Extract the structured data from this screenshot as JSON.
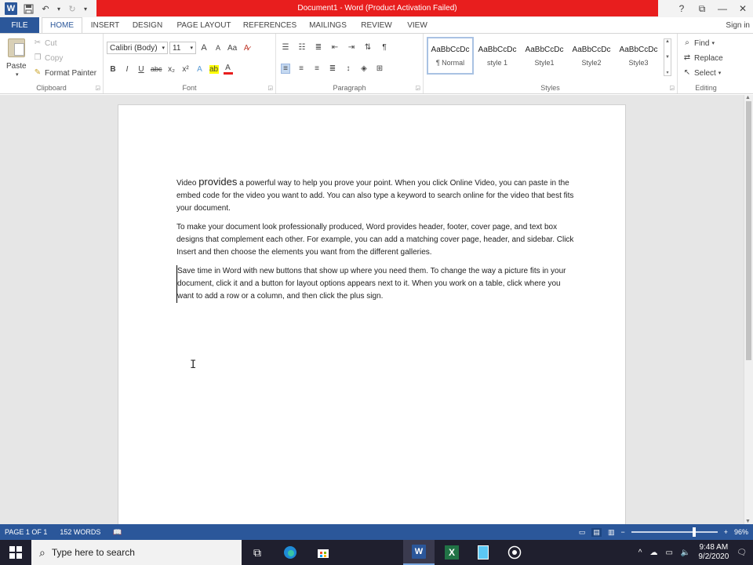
{
  "window": {
    "title": "Document1 - Word (Product Activation Failed)",
    "help_glyph": "?",
    "controls": [
      "?",
      "⧉",
      "—",
      "✕"
    ]
  },
  "qat": {
    "undo_glyph": "↶",
    "redo_glyph": "↻",
    "more_glyph": "▾"
  },
  "tabs": [
    "FILE",
    "HOME",
    "INSERT",
    "DESIGN",
    "PAGE LAYOUT",
    "REFERENCES",
    "MAILINGS",
    "REVIEW",
    "VIEW"
  ],
  "signin": "Sign in",
  "clipboard": {
    "paste": "Paste",
    "cut": "Cut",
    "copy": "Copy",
    "format_painter": "Format Painter",
    "label": "Clipboard"
  },
  "font": {
    "font_name": "Calibri (Body)",
    "font_size": "11",
    "grow": "A",
    "shrink": "A",
    "case": "Aa",
    "bold": "B",
    "italic": "I",
    "underline": "U",
    "strike": "abc",
    "subscript": "x₂",
    "superscript": "x²",
    "label": "Font"
  },
  "paragraph": {
    "label": "Paragraph"
  },
  "styles": {
    "items": [
      {
        "preview": "AaBbCcDc",
        "name": "¶ Normal"
      },
      {
        "preview": "AaBbCcDc",
        "name": "style 1"
      },
      {
        "preview": "AaBbCcDc",
        "name": "Style1"
      },
      {
        "preview": "AaBbCcDc",
        "name": "Style2"
      },
      {
        "preview": "AaBbCcDc",
        "name": "Style3"
      }
    ],
    "label": "Styles"
  },
  "editing": {
    "find": "Find",
    "replace": "Replace",
    "select": "Select",
    "label": "Editing"
  },
  "document": {
    "p1_word1": "Video",
    "p1_word2": "provides",
    "p1_rest": "a powerful way to help you prove your point. When you click Online Video, you can paste in the embed code for the video you want to add. You can also type a keyword to search online for the video that best fits your document.",
    "p2": "To make your document look professionally produced, Word provides header, footer, cover page, and text box designs that complement each other. For example, you can add a matching cover page, header, and sidebar. Click Insert and then choose the elements you want from the different galleries.",
    "p3": "Save time in Word with new buttons that show up where you need them. To change the way a picture fits in your document, click it and a button for layout options appears next to it. When you work on a table, click where you want to add a row or a column, and then click the plus sign."
  },
  "status": {
    "page": "PAGE 1 OF 1",
    "words": "152 WORDS",
    "zoom": "96%",
    "zoom_level": 0.96,
    "zoom_out": "−",
    "zoom_in": "+"
  },
  "taskbar": {
    "search_placeholder": "Type here to search",
    "time": "9:48 AM",
    "date": "9/2/2020"
  },
  "colors": {
    "word_blue": "#2b579a",
    "title_red": "#e81e1e",
    "taskbar": "#1f1f2e"
  }
}
